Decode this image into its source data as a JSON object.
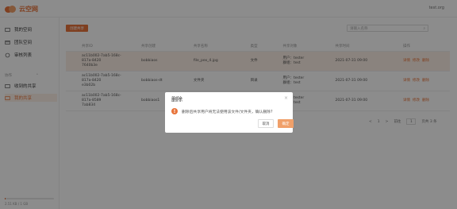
{
  "app": {
    "name": "云空网",
    "user": "test.org"
  },
  "sidebar": {
    "items": [
      {
        "label": "我的空间",
        "icon": "folder-icon"
      },
      {
        "label": "团队空间",
        "icon": "team-folder-icon"
      },
      {
        "label": "审核列表",
        "icon": "audit-icon"
      }
    ],
    "section": "协作",
    "sub_items": [
      {
        "label": "收到的共享",
        "icon": "inbox-icon"
      },
      {
        "label": "我的共享",
        "icon": "share-icon"
      }
    ],
    "storage_text": "2.51 KB / 1 GB",
    "storage_percent": 2
  },
  "toolbar": {
    "create_label": "创建共享",
    "search_placeholder": "请输入名称"
  },
  "table": {
    "headers": [
      "共享ID",
      "共享创建",
      "共享名称",
      "类型",
      "共享对象",
      "共享时间",
      "操作"
    ],
    "rows": [
      {
        "id_l1": "ac11b002-7ab5-168c-817a-8420",
        "id_l2": "7640b3e",
        "creator": "bobbiaos",
        "name": "file_pex_4.jpg",
        "type": "文件",
        "obj1": "用户：tester",
        "obj2": "群组：test",
        "time": "2021-07-31 09:00",
        "ops": [
          "详情",
          "修改",
          "删除"
        ]
      },
      {
        "id_l1": "ac11b002-7ab5-168c-817a-8420",
        "id_l2": "e3b02b",
        "creator": "bobbiaos-dt",
        "name": "文件夹",
        "type": "目录",
        "obj1": "用户：tester",
        "obj2": "群组：test",
        "time": "2021-07-31 09:00",
        "ops": [
          "详情",
          "修改",
          "删除"
        ]
      },
      {
        "id_l1": "ac11b002-7ab5-168c-817a-8589",
        "id_l2": "7ab834",
        "creator": "bobbiaos1",
        "name": "文件",
        "type": "文件",
        "obj1": "用户：tester",
        "obj2": "群组：test",
        "time": "2021-07-31 09:00",
        "ops": [
          "详情",
          "修改",
          "删除"
        ]
      }
    ]
  },
  "pager": {
    "prev": "<",
    "page": "1",
    "next": ">",
    "goto_label": "前往",
    "goto_value": "1",
    "total": "页共 3 条"
  },
  "dialog": {
    "title": "删除",
    "message": "删除后共享用户将无法使用该文件/文件夹，确认删除?",
    "cancel": "取消",
    "ok": "确定",
    "close": "×",
    "warn_glyph": "!"
  },
  "colors": {
    "accent": "#e8743b"
  }
}
